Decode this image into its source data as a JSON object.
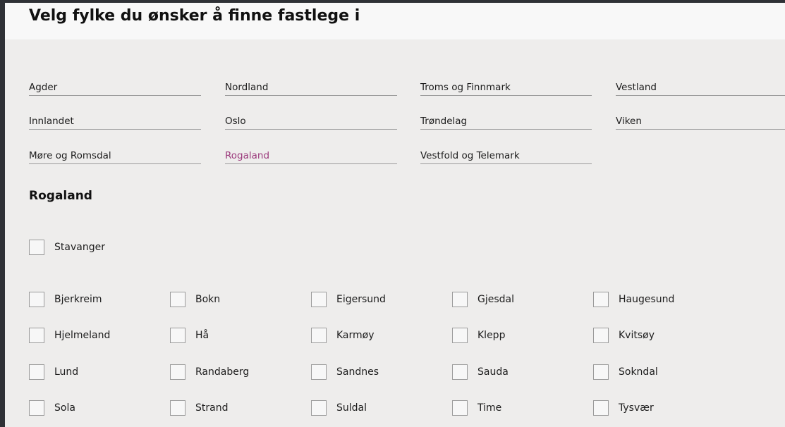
{
  "header": {
    "title": "Velg fylke du ønsker å finne fastlege i"
  },
  "counties": [
    {
      "label": "Agder"
    },
    {
      "label": "Nordland"
    },
    {
      "label": "Troms og Finnmark"
    },
    {
      "label": "Vestland"
    },
    {
      "label": "Innlandet"
    },
    {
      "label": "Oslo"
    },
    {
      "label": "Trøndelag"
    },
    {
      "label": "Viken"
    },
    {
      "label": "Møre og Romsdal"
    },
    {
      "label": "Rogaland",
      "selected": true
    },
    {
      "label": "Vestfold og Telemark"
    }
  ],
  "selected_county": {
    "title": "Rogaland",
    "featured": [
      {
        "label": "Stavanger",
        "checked": false
      }
    ],
    "municipalities": [
      {
        "label": "Bjerkreim",
        "checked": false
      },
      {
        "label": "Bokn",
        "checked": false
      },
      {
        "label": "Eigersund",
        "checked": false
      },
      {
        "label": "Gjesdal",
        "checked": false
      },
      {
        "label": "Haugesund",
        "checked": false
      },
      {
        "label": "Hjelmeland",
        "checked": false
      },
      {
        "label": "Hå",
        "checked": false
      },
      {
        "label": "Karmøy",
        "checked": false
      },
      {
        "label": "Klepp",
        "checked": false
      },
      {
        "label": "Kvitsøy",
        "checked": false
      },
      {
        "label": "Lund",
        "checked": false
      },
      {
        "label": "Randaberg",
        "checked": false
      },
      {
        "label": "Sandnes",
        "checked": false
      },
      {
        "label": "Sauda",
        "checked": false
      },
      {
        "label": "Sokndal",
        "checked": false
      },
      {
        "label": "Sola",
        "checked": false
      },
      {
        "label": "Strand",
        "checked": false
      },
      {
        "label": "Suldal",
        "checked": false
      },
      {
        "label": "Time",
        "checked": false
      },
      {
        "label": "Tysvær",
        "checked": false
      }
    ]
  },
  "colors": {
    "accent": "#9b3a7c",
    "background": "#eeedec",
    "outer": "#2f3136"
  }
}
